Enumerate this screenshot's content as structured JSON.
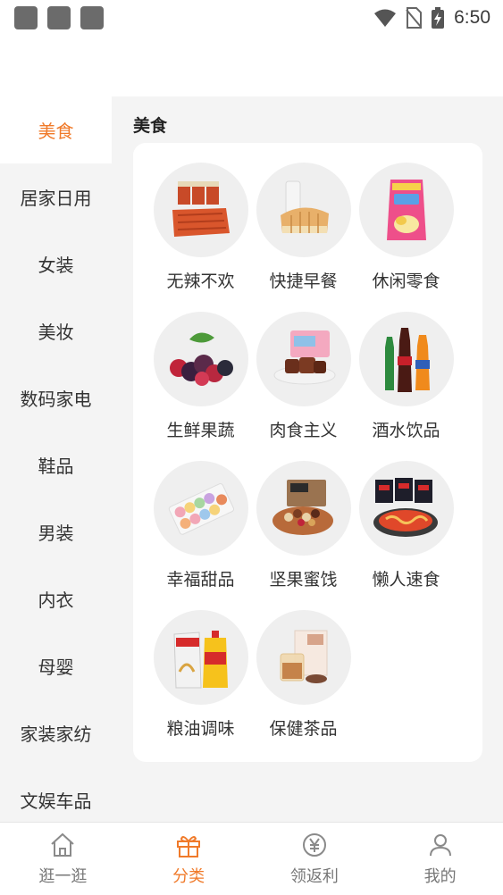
{
  "status_bar": {
    "time": "6:50",
    "icons": [
      "notification-square-icon",
      "notification-square-icon",
      "notification-square-icon",
      "wifi-icon",
      "no-sim-icon",
      "battery-charging-icon"
    ]
  },
  "sidebar": {
    "items": [
      {
        "label": "美食",
        "active": true
      },
      {
        "label": "居家日用"
      },
      {
        "label": "女装"
      },
      {
        "label": "美妆"
      },
      {
        "label": "数码家电"
      },
      {
        "label": "鞋品"
      },
      {
        "label": "男装"
      },
      {
        "label": "内衣"
      },
      {
        "label": "母婴"
      },
      {
        "label": "家装家纺"
      },
      {
        "label": "文娱车品"
      }
    ]
  },
  "main": {
    "section_title": "美食",
    "categories": [
      {
        "label": "无辣不欢",
        "icon": "spicy-snack-icon"
      },
      {
        "label": "快捷早餐",
        "icon": "bread-milk-icon"
      },
      {
        "label": "休闲零食",
        "icon": "chips-bag-icon"
      },
      {
        "label": "生鲜果蔬",
        "icon": "berries-icon"
      },
      {
        "label": "肉食主义",
        "icon": "braised-meat-icon"
      },
      {
        "label": "酒水饮品",
        "icon": "soda-bottles-icon"
      },
      {
        "label": "幸福甜品",
        "icon": "macaron-box-icon"
      },
      {
        "label": "坚果蜜饯",
        "icon": "nuts-basket-icon"
      },
      {
        "label": "懒人速食",
        "icon": "instant-noodles-icon"
      },
      {
        "label": "粮油调味",
        "icon": "rice-oil-icon"
      },
      {
        "label": "保健茶品",
        "icon": "tea-box-icon"
      }
    ]
  },
  "bottom_nav": {
    "items": [
      {
        "label": "逛一逛",
        "icon": "home-icon"
      },
      {
        "label": "分类",
        "icon": "gift-icon",
        "active": true
      },
      {
        "label": "领返利",
        "icon": "yuan-coin-icon"
      },
      {
        "label": "我的",
        "icon": "user-icon"
      }
    ]
  },
  "colors": {
    "accent": "#f07a2a",
    "background": "#f4f4f4",
    "card": "#ffffff"
  }
}
